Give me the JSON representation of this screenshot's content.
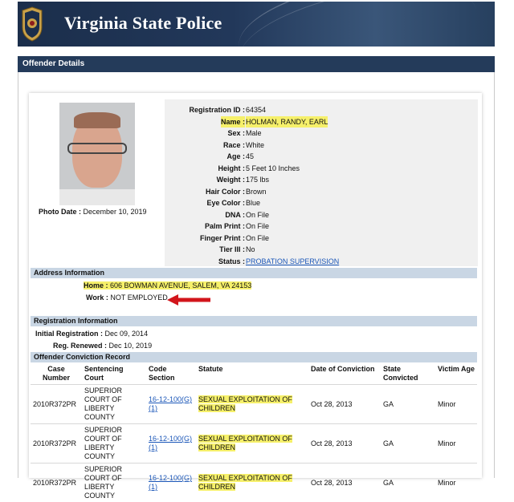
{
  "header": {
    "title": "Virginia State Police"
  },
  "page_title": "Offender Details",
  "photo_date": {
    "label": "Photo Date :",
    "value": "December 10, 2019"
  },
  "details": [
    {
      "label": "Registration ID :",
      "value": "64354",
      "highlight": false
    },
    {
      "label": "Name :",
      "value": "HOLMAN, RANDY, EARL",
      "highlight": true
    },
    {
      "label": "Sex :",
      "value": "Male",
      "highlight": false
    },
    {
      "label": "Race :",
      "value": "White",
      "highlight": false
    },
    {
      "label": "Age :",
      "value": "45",
      "highlight": false
    },
    {
      "label": "Height :",
      "value": "5 Feet 10 Inches",
      "highlight": false
    },
    {
      "label": "Weight :",
      "value": "175 lbs",
      "highlight": false
    },
    {
      "label": "Hair Color :",
      "value": "Brown",
      "highlight": false
    },
    {
      "label": "Eye Color :",
      "value": "Blue",
      "highlight": false
    },
    {
      "label": "DNA :",
      "value": "On File",
      "highlight": false
    },
    {
      "label": "Palm Print :",
      "value": "On File",
      "highlight": false
    },
    {
      "label": "Finger Print :",
      "value": "On File",
      "highlight": false
    },
    {
      "label": "Tier III :",
      "value": "No",
      "highlight": false
    },
    {
      "label": "Status :",
      "value": "PROBATION SUPERVISION",
      "highlight": false
    }
  ],
  "address": {
    "heading": "Address Information",
    "home_label": "Home :",
    "home_value": "606 BOWMAN AVENUE, SALEM, VA 24153",
    "work_label": "Work :",
    "work_value": "NOT EMPLOYED"
  },
  "registration": {
    "heading": "Registration Information",
    "initial_label": "Initial Registration :",
    "initial_value": "Dec 09, 2014",
    "renewed_label": "Reg. Renewed :",
    "renewed_value": "Dec 10, 2019"
  },
  "convictions": {
    "heading": "Offender Conviction Record",
    "columns": [
      "Case Number",
      "Sentencing Court",
      "Code Section",
      "Statute",
      "Date of Conviction",
      "State Convicted",
      "Victim Age"
    ],
    "rows": [
      {
        "case": "2010R372PR",
        "court": "SUPERIOR COURT OF LIBERTY COUNTY",
        "code": "16-12-100(G)(1)",
        "statute": "SEXUAL EXPLOITATION OF CHILDREN",
        "date": "Oct 28, 2013",
        "state": "GA",
        "victim_age": "Minor"
      },
      {
        "case": "2010R372PR",
        "court": "SUPERIOR COURT OF LIBERTY COUNTY",
        "code": "16-12-100(G)(1)",
        "statute": "SEXUAL EXPLOITATION OF CHILDREN",
        "date": "Oct 28, 2013",
        "state": "GA",
        "victim_age": "Minor"
      },
      {
        "case": "2010R372PR",
        "court": "SUPERIOR COURT OF LIBERTY COUNTY",
        "code": "16-12-100(G)(1)",
        "statute": "SEXUAL EXPLOITATION OF CHILDREN",
        "date": "Oct 28, 2013",
        "state": "GA",
        "victim_age": "Minor"
      }
    ]
  },
  "colors": {
    "header": "#243b5a",
    "highlight": "#f6f06a",
    "link": "#1a56b8",
    "arrow": "#d2151b",
    "section": "#c9d6e4"
  },
  "icons": {
    "badge": "vsp-badge-icon",
    "arrow": "red-arrow-icon"
  }
}
